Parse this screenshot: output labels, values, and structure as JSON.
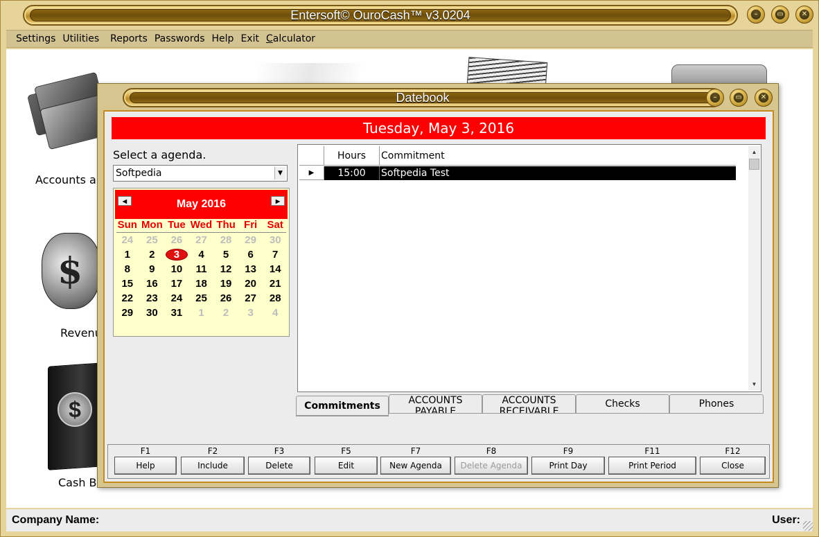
{
  "app": {
    "title": "Entersoft© OuroCash™ v3.0204",
    "menu": [
      {
        "label": "Settings"
      },
      {
        "label": "Utilities"
      },
      {
        "label": "Reports"
      },
      {
        "label": "Passwords"
      },
      {
        "label": "Help"
      },
      {
        "label": "Exit"
      },
      {
        "label": "Calculator"
      }
    ],
    "background_labels": {
      "accounts": "Accounts an",
      "revenue": "Revenu",
      "cash_book": "Cash Bo"
    },
    "status": {
      "company": "Company Name:",
      "user": "User:"
    },
    "window_buttons": {
      "minimize": "–",
      "restore": "▭",
      "close": "✕"
    }
  },
  "datebook": {
    "title": "Datebook",
    "date_header": "Tuesday, May 3, 2016",
    "agenda_label": "Select a agenda.",
    "agenda_value": "Softpedia",
    "calendar": {
      "month_label": "May 2016",
      "prev": "◀",
      "next": "▶",
      "weekdays": [
        "Sun",
        "Mon",
        "Tue",
        "Wed",
        "Thu",
        "Fri",
        "Sat"
      ],
      "weeks": [
        [
          {
            "d": "24",
            "o": 1
          },
          {
            "d": "25",
            "o": 1
          },
          {
            "d": "26",
            "o": 1
          },
          {
            "d": "27",
            "o": 1
          },
          {
            "d": "28",
            "o": 1
          },
          {
            "d": "29",
            "o": 1
          },
          {
            "d": "30",
            "o": 1
          }
        ],
        [
          {
            "d": "1"
          },
          {
            "d": "2"
          },
          {
            "d": "3",
            "s": 1
          },
          {
            "d": "4"
          },
          {
            "d": "5"
          },
          {
            "d": "6"
          },
          {
            "d": "7"
          }
        ],
        [
          {
            "d": "8"
          },
          {
            "d": "9"
          },
          {
            "d": "10"
          },
          {
            "d": "11"
          },
          {
            "d": "12"
          },
          {
            "d": "13"
          },
          {
            "d": "14"
          }
        ],
        [
          {
            "d": "15"
          },
          {
            "d": "16"
          },
          {
            "d": "17"
          },
          {
            "d": "18"
          },
          {
            "d": "19"
          },
          {
            "d": "20"
          },
          {
            "d": "21"
          }
        ],
        [
          {
            "d": "22"
          },
          {
            "d": "23"
          },
          {
            "d": "24"
          },
          {
            "d": "25"
          },
          {
            "d": "26"
          },
          {
            "d": "27"
          },
          {
            "d": "28"
          }
        ],
        [
          {
            "d": "29"
          },
          {
            "d": "30"
          },
          {
            "d": "31"
          },
          {
            "d": "1",
            "o": 1
          },
          {
            "d": "2",
            "o": 1
          },
          {
            "d": "3",
            "o": 1
          },
          {
            "d": "4",
            "o": 1
          }
        ]
      ]
    },
    "grid": {
      "columns": {
        "hours": "Hours",
        "commitment": "Commitment"
      },
      "rows": [
        {
          "indicator": "▶",
          "hours": "15:00",
          "commitment": "Softpedia Test"
        }
      ]
    },
    "tabs": [
      {
        "label": "Commitments",
        "active": true
      },
      {
        "label": "ACCOUNTS PAYABLE"
      },
      {
        "label": "ACCOUNTS RECEIVABLE"
      },
      {
        "label": "Checks"
      },
      {
        "label": "Phones"
      }
    ],
    "function_keys": [
      {
        "key": "F1",
        "label": "Help"
      },
      {
        "key": "F2",
        "label": "Include"
      },
      {
        "key": "F3",
        "label": "Delete"
      },
      {
        "key": "F5",
        "label": "Edit"
      },
      {
        "key": "F7",
        "label": "New Agenda"
      },
      {
        "key": "F8",
        "label": "Delete Agenda",
        "disabled": true
      },
      {
        "key": "F9",
        "label": "Print Day"
      },
      {
        "key": "F11",
        "label": "Print Period"
      },
      {
        "key": "F12",
        "label": "Close"
      }
    ]
  },
  "colors": {
    "header_red": "#ff0000",
    "calendar_bg": "#ffffcc",
    "gold_frame": "#c28a20",
    "selected_row": "#000000"
  }
}
